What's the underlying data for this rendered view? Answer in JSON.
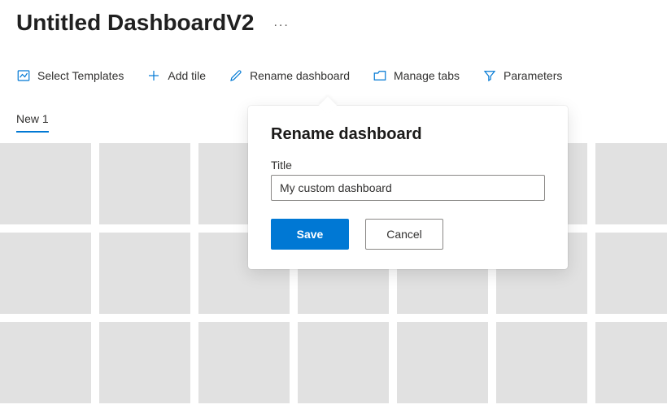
{
  "header": {
    "title": "Untitled DashboardV2",
    "more_button": "..."
  },
  "toolbar": {
    "select_templates": "Select Templates",
    "add_tile": "Add tile",
    "rename_dashboard": "Rename dashboard",
    "manage_tabs": "Manage tabs",
    "parameters": "Parameters"
  },
  "tabs": [
    {
      "label": "New 1",
      "active": true
    }
  ],
  "tile_count": 21,
  "modal": {
    "heading": "Rename dashboard",
    "title_label": "Title",
    "title_value": "My custom dashboard",
    "save_label": "Save",
    "cancel_label": "Cancel"
  },
  "colors": {
    "accent": "#0078d4",
    "tile_bg": "#e1e1e1"
  }
}
